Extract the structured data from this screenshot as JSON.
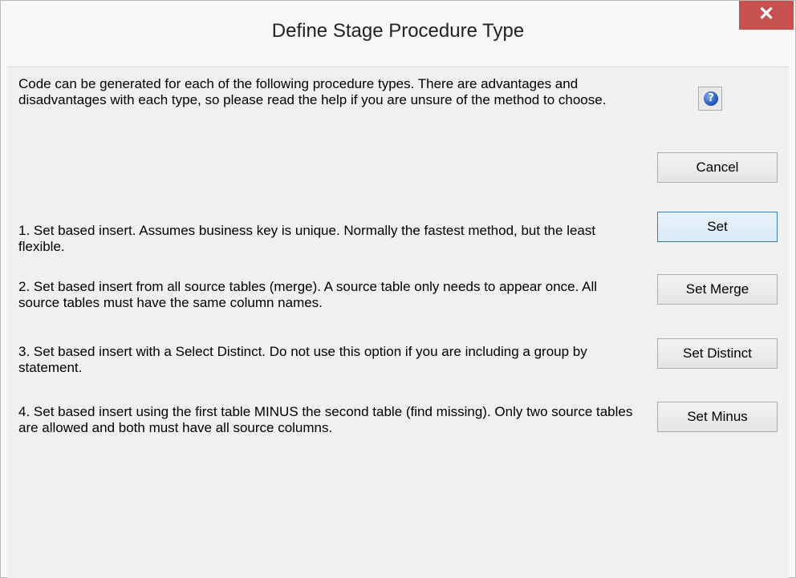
{
  "window": {
    "title": "Define Stage Procedure Type",
    "close_label": "✕"
  },
  "intro_text": "Code can be generated for each of the following procedure types. There are advantages and disadvantages with each type, so please read the help if you are unsure of the method to choose.",
  "help_button": {
    "label": "?"
  },
  "cancel_button": "Cancel",
  "options": [
    {
      "description": "1. Set based insert. Assumes business key is unique. Normally the fastest method, but the least flexible.",
      "button_label": "Set"
    },
    {
      "description": "2. Set based insert from all source tables (merge). A source table only needs to appear once. All source tables must have the same column names.",
      "button_label": "Set Merge"
    },
    {
      "description": "3. Set based insert with a Select Distinct.   Do not use this option if you are including a group by statement.",
      "button_label": "Set Distinct"
    },
    {
      "description": "4. Set based insert using the first table MINUS the second table (find missing). Only two source tables are allowed and both must have all source columns.",
      "button_label": "Set Minus"
    }
  ]
}
